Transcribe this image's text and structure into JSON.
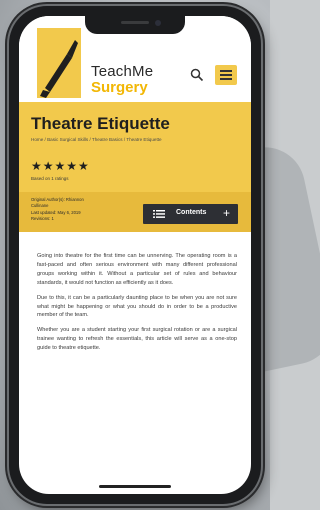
{
  "header": {
    "brand_line1": "TeachMe",
    "brand_line2": "Surgery",
    "search_icon": "search-icon",
    "menu_icon": "hamburger-menu-icon"
  },
  "page": {
    "title": "Theatre Etiquette",
    "breadcrumb": "Home  /  Basic Surgical Skills  /  Theatre Basics  /  Theatre Etiquette",
    "rating_stars": "★★★★★",
    "rating_count": "Based on 1 ratings"
  },
  "meta": {
    "original_author_label": "Original Author(s): Rhiannon",
    "original_author_name": "Cullinane",
    "last_updated": "Last updated: May 6, 2019",
    "revisions": "Revisions: 1"
  },
  "contents_button": {
    "label": "Contents",
    "plus": "+"
  },
  "article": {
    "paragraphs": [
      "Going into theatre for the first time can be unnerving. The operating room is a fast-paced and often serious environment with many different professional groups working within it. Without a particular set of rules and behaviour standards, it would not function as efficiently as it does.",
      "Due to this, it can be a particularly daunting place to be when you are not sure what might be happening or what you should do in order to be a productive member of the team.",
      "Whether you are a student starting your first surgical rotation or are a surgical trainee wanting to refresh the essentials, this article will serve as a one-stop guide to theatre etiquette."
    ]
  },
  "colors": {
    "accent_yellow": "#f2c94c",
    "meta_yellow": "#e7ba3c",
    "dark_button": "#2d2f34"
  }
}
